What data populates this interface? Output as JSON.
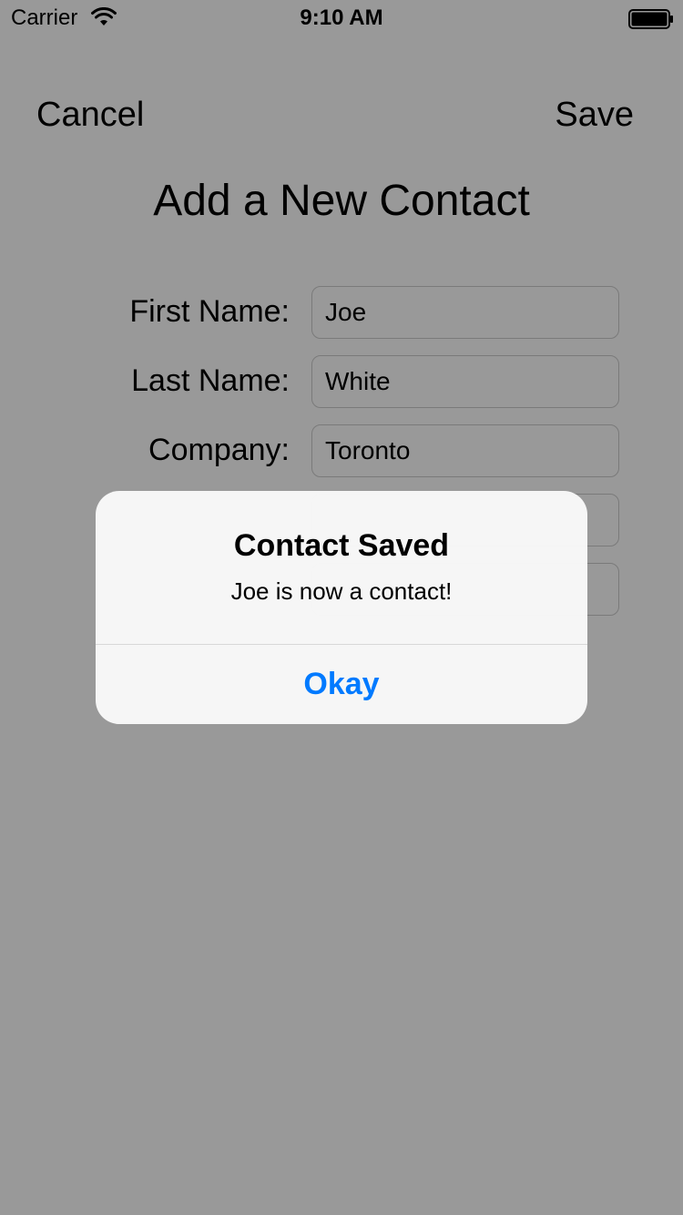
{
  "status_bar": {
    "carrier": "Carrier",
    "time": "9:10 AM",
    "icons": [
      "wifi-icon",
      "battery-icon"
    ]
  },
  "nav": {
    "cancel_label": "Cancel",
    "save_label": "Save"
  },
  "page": {
    "title": "Add a New Contact"
  },
  "form": {
    "fields": [
      {
        "label": "First Name:",
        "value": "Joe"
      },
      {
        "label": "Last Name:",
        "value": "White"
      },
      {
        "label": "Company:",
        "value": "Toronto"
      },
      {
        "label": "",
        "value": ""
      },
      {
        "label": "",
        "value": ""
      }
    ]
  },
  "alert": {
    "title": "Contact Saved",
    "message": "Joe is now a contact!",
    "button_label": "Okay"
  },
  "colors": {
    "accent": "#007aff",
    "overlay": "#000000"
  }
}
